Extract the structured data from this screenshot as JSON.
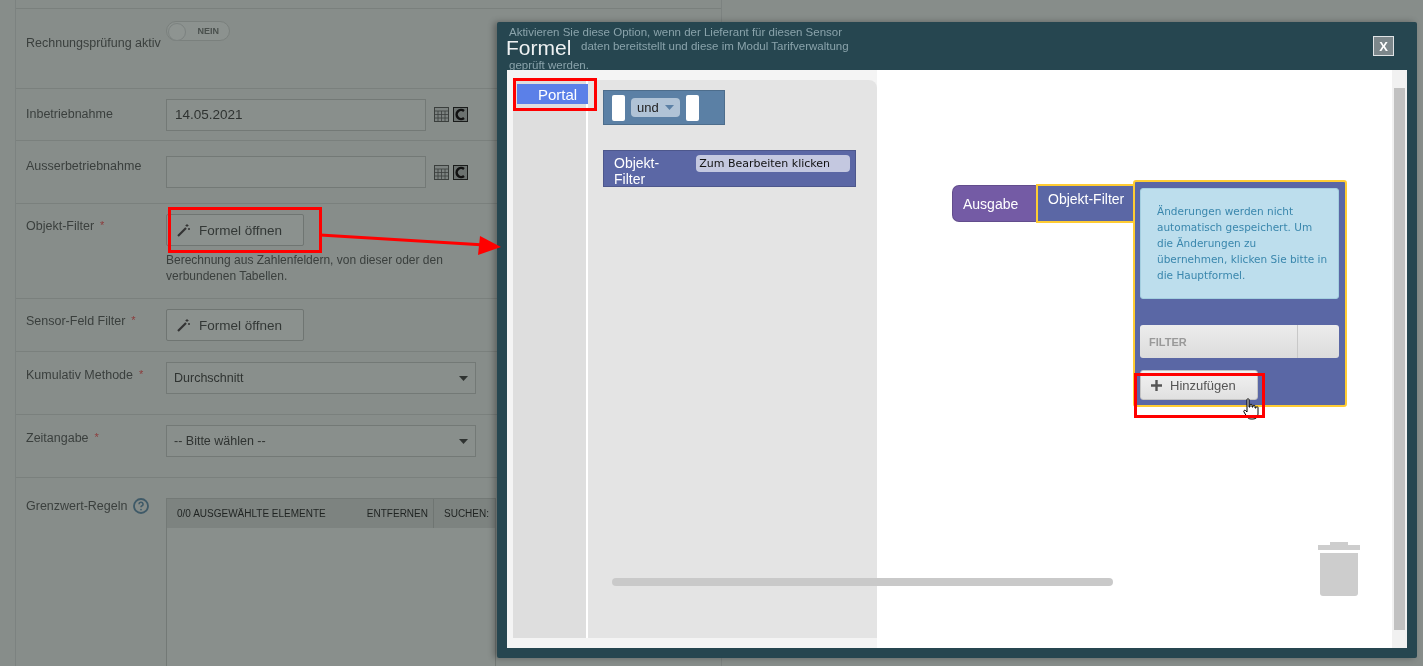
{
  "form": {
    "rows": [
      {
        "kind": "toggle",
        "label": "Rechnungsprüfung aktiv",
        "on": false,
        "toggle_text": "NEIN"
      },
      {
        "kind": "date",
        "label": "Inbetriebnahme",
        "value": "14.05.2021"
      },
      {
        "kind": "date",
        "label": "Ausserbetriebnahme"
      },
      {
        "kind": "formula",
        "label": "Objekt-Filter",
        "required_mark": "*",
        "button": "Formel öffnen",
        "help": "Berechnung aus Zahlenfeldern, von dieser oder den verbundenen Tabellen."
      },
      {
        "kind": "formula",
        "label": "Sensor-Feld Filter",
        "required_mark": "*",
        "button": "Formel öffnen"
      },
      {
        "kind": "select",
        "label": "Kumulativ Methode",
        "required_mark": "*",
        "value": "Durchschnitt"
      },
      {
        "kind": "select",
        "label": "Zeitangabe",
        "required_mark": "*",
        "value": "-- Bitte wählen --"
      },
      {
        "kind": "picklist",
        "label": "Grenzwert-Regeln",
        "header": "0/0 AUSGEWÄHLTE ELEMENTE",
        "action": "ENTFERNEN",
        "search": "SUCHEN:"
      }
    ]
  },
  "dialog": {
    "title": "Formel",
    "close": "X",
    "background_hint": [
      "Aktivieren Sie diese Option, wenn der Lieferant für diesen Sensor",
      "daten bereitstellt und diese im Modul Tarifverwaltung",
      "geprüft werden."
    ],
    "toolbox": {
      "categories": [
        {
          "label": "Portal",
          "selected": true
        }
      ],
      "blocks": [
        {
          "kind": "logic",
          "label": "und"
        },
        {
          "kind": "filter",
          "label": "Objekt-Filter",
          "field": "Zum Bearbeiten klicken"
        }
      ]
    },
    "workspace": {
      "output_block": "Ausgabe",
      "filter_block": "Objekt-Filter",
      "popup": {
        "note": "Änderungen werden nicht automatisch gespeichert. Um die Änderungen zu übernehmen, klicken Sie bitte in die Hauptformel.",
        "column": "FILTER",
        "add_button": "Hinzufügen"
      }
    }
  }
}
